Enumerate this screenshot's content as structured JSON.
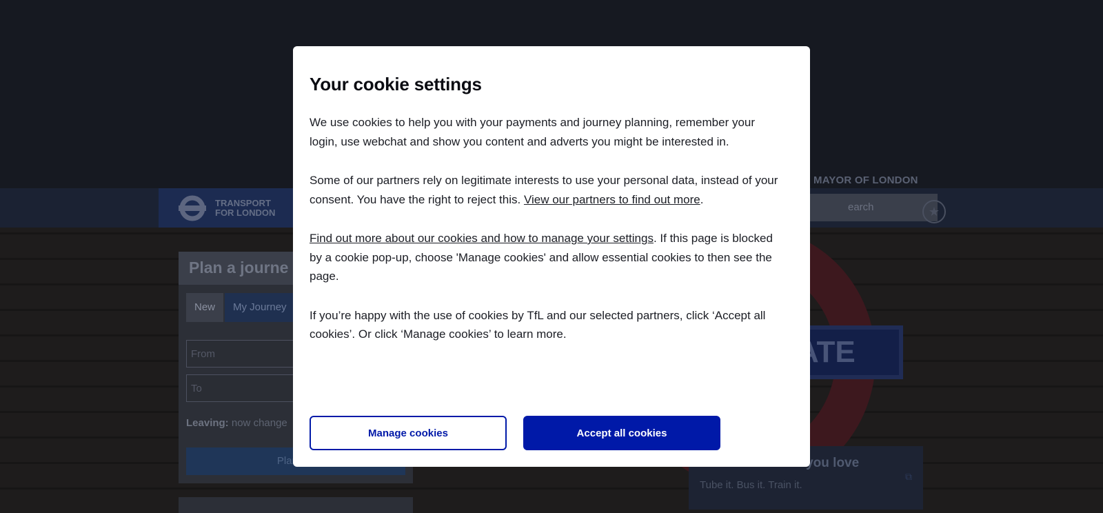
{
  "modal": {
    "title": "Your cookie settings",
    "p1": "We use cookies to help you with your payments and journey planning, remember your login, use webchat and show you content and adverts you might be interested in.",
    "p2_text": "Some of our partners rely on legitimate interests to use your personal data, instead of your consent. You have the right to reject this. ",
    "p2_link": "View our partners to find out more",
    "p2_end": ".",
    "p3_link": "Find out more about our cookies and how to manage your settings",
    "p3_text": ". If this page is blocked by a cookie pop-up, choose 'Manage cookies' and allow essential cookies to then see the page.",
    "p4": "If you’re happy with the use of cookies by TfL and our selected partners, click ‘Accept all cookies’. Or click ‘Manage cookies’ to learn more.",
    "manage_label": "Manage cookies",
    "accept_label": "Accept all cookies",
    "colors": {
      "primary": "#0019a8"
    }
  },
  "header": {
    "logo_line1": "TRANSPORT",
    "logo_line2": "FOR LONDON",
    "mayor_label": "MAYOR OF LONDON",
    "search_placeholder": "earch"
  },
  "planner": {
    "title": "Plan a journe",
    "tabs": [
      "New",
      "My Journey"
    ],
    "from_placeholder": "From",
    "to_placeholder": "To",
    "leaving_label": "Leaving:",
    "leaving_value": "now",
    "change_label": "change",
    "plan_button": "Plan my"
  },
  "hero": {
    "sign_text": "ATE"
  },
  "promo": {
    "title": "Do more of what you love",
    "subtitle": "Tube it. Bus it. Train it."
  }
}
